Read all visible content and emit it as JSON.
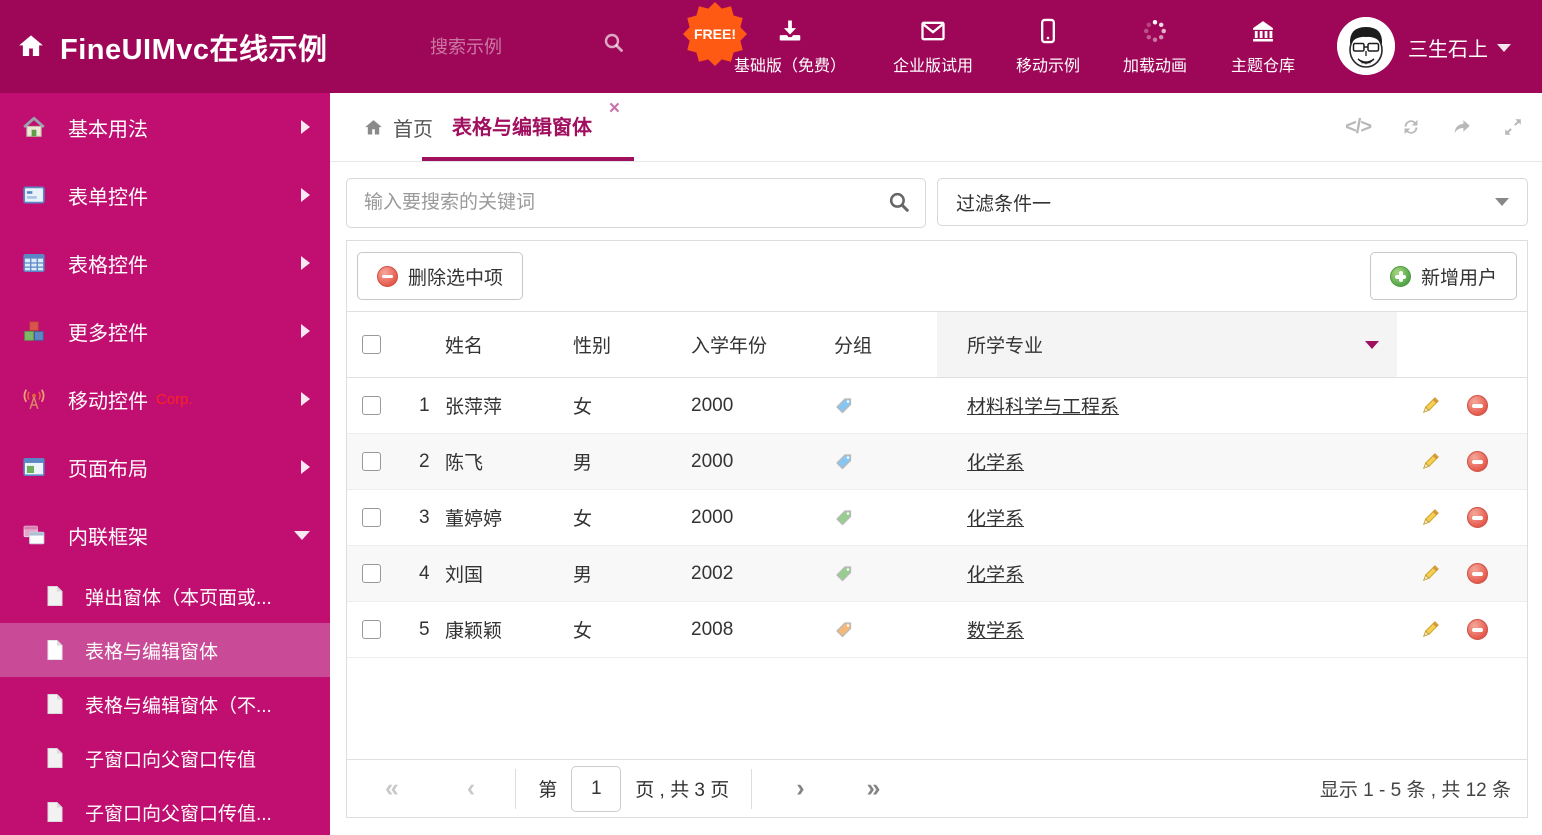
{
  "colors": {
    "accent": "#A0105F",
    "topbar_bg": "#9E0758",
    "sidebar_bg": "#C00F70",
    "sidebar_active_bg": "#C94A96",
    "free_badge_bg": "#FF5A13",
    "tag_blue": "#85C6F2",
    "tag_green": "#96CE8E",
    "tag_orange": "#F6B877"
  },
  "topbar": {
    "brand": "FineUIMvc在线示例",
    "search_placeholder": "搜索示例",
    "free_badge": "FREE!",
    "nav": [
      {
        "label": "基础版（免费）",
        "icon": "download-icon"
      },
      {
        "label": "企业版试用",
        "icon": "envelope-icon"
      },
      {
        "label": "移动示例",
        "icon": "mobile-icon"
      },
      {
        "label": "加载动画",
        "icon": "spinner-icon"
      },
      {
        "label": "主题仓库",
        "icon": "bank-icon"
      }
    ],
    "user": {
      "name": "三生石上"
    }
  },
  "sidebar": {
    "items": [
      {
        "label": "基本用法",
        "icon": "home-icon"
      },
      {
        "label": "表单控件",
        "icon": "form-icon"
      },
      {
        "label": "表格控件",
        "icon": "table-icon"
      },
      {
        "label": "更多控件",
        "icon": "cubes-icon"
      },
      {
        "label": "移动控件",
        "badge": "Corp.",
        "icon": "antenna-icon"
      },
      {
        "label": "页面布局",
        "icon": "layout-icon"
      },
      {
        "label": "内联框架",
        "icon": "frames-icon",
        "expanded": true
      }
    ],
    "subitems": [
      {
        "label": "弹出窗体（本页面或..."
      },
      {
        "label": "表格与编辑窗体",
        "active": true
      },
      {
        "label": "表格与编辑窗体（不..."
      },
      {
        "label": "子窗口向父窗口传值"
      },
      {
        "label": "子窗口向父窗口传值..."
      }
    ]
  },
  "tabs": {
    "home": "首页",
    "active": "表格与编辑窗体",
    "close": "×"
  },
  "tab_tools": {
    "code": "</>"
  },
  "filters": {
    "search_placeholder": "输入要搜索的关键词",
    "selected_filter": "过滤条件一"
  },
  "grid": {
    "toolbar": {
      "delete_label": "删除选中项",
      "add_label": "新增用户"
    },
    "columns": {
      "name": "姓名",
      "gender": "性别",
      "year": "入学年份",
      "group": "分组",
      "major": "所学专业"
    },
    "rows": [
      {
        "num": "1",
        "name": "张萍萍",
        "gender": "女",
        "year": "2000",
        "tag_color": "blue",
        "major": "材料科学与工程系"
      },
      {
        "num": "2",
        "name": "陈飞",
        "gender": "男",
        "year": "2000",
        "tag_color": "blue",
        "major": "化学系"
      },
      {
        "num": "3",
        "name": "董婷婷",
        "gender": "女",
        "year": "2000",
        "tag_color": "green",
        "major": "化学系"
      },
      {
        "num": "4",
        "name": "刘国",
        "gender": "男",
        "year": "2002",
        "tag_color": "green",
        "major": "化学系"
      },
      {
        "num": "5",
        "name": "康颖颖",
        "gender": "女",
        "year": "2008",
        "tag_color": "orange",
        "major": "数学系"
      }
    ],
    "pager": {
      "first": "«",
      "prev": "‹",
      "next": "›",
      "last": "»",
      "page_prefix": "第",
      "page_value": "1",
      "page_suffix": "页 , 共 3 页",
      "summary": "显示 1 - 5 条 , 共 12 条"
    }
  }
}
